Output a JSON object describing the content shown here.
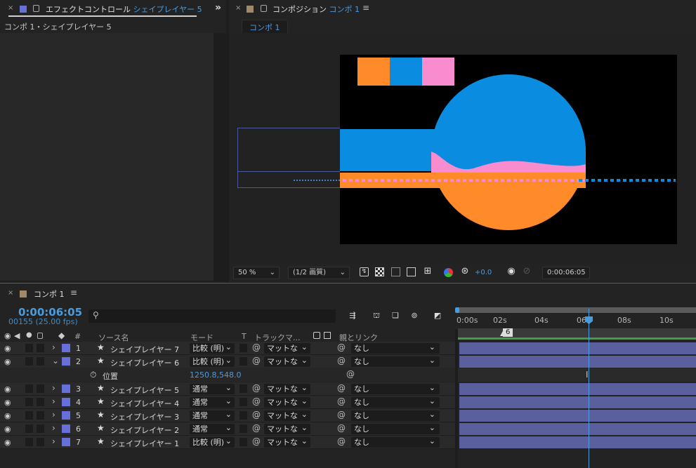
{
  "effect_panel": {
    "close": "×",
    "tab_label": "エフェクトコントロール",
    "tab_layer": "シェイプレイヤー 5",
    "menu_icon": "»",
    "breadcrumb": "コンポ 1・シェイプレイヤー 5",
    "layer_color": "#6670d8"
  },
  "comp_panel": {
    "close": "×",
    "tab_label": "コンポジション",
    "tab_comp": "コンポ 1",
    "menu": "≡",
    "comp_pill": "コンポ 1",
    "swatch_color": "#a08a6a"
  },
  "comp_toolbar": {
    "zoom": "50 %",
    "quality": "(1/2 画質)",
    "exposure": "+0.0",
    "timecode": "0:00:06:05"
  },
  "timeline": {
    "close": "×",
    "tab_label": "コンポ 1",
    "menu": "≡",
    "timecode": "0:00:06:05",
    "frames": "00155 (25.00 fps)",
    "search_placeholder": "",
    "headers": {
      "num": "#",
      "source": "ソース名",
      "mode": "モード",
      "t": "T",
      "track": "トラックマ...",
      "parent": "親とリンク"
    },
    "ruler": [
      "0:00s",
      "02s",
      "04s",
      "06",
      "08s",
      "10s"
    ],
    "marker": "6",
    "prop_name": "位置",
    "prop_value": "1250.8,548.0",
    "layers": [
      {
        "num": "1",
        "name": "シェイプレイヤー 7",
        "mode": "比較 (明)",
        "track": "マットな",
        "parent": "なし",
        "arrow": "›"
      },
      {
        "num": "2",
        "name": "シェイプレイヤー 6",
        "mode": "比較 (明)",
        "track": "マットな",
        "parent": "なし",
        "arrow": "⌄"
      },
      {
        "num": "3",
        "name": "シェイプレイヤー 5",
        "mode": "通常",
        "track": "マットな",
        "parent": "なし",
        "arrow": "›"
      },
      {
        "num": "4",
        "name": "シェイプレイヤー 4",
        "mode": "通常",
        "track": "マットな",
        "parent": "なし",
        "arrow": "›"
      },
      {
        "num": "5",
        "name": "シェイプレイヤー 3",
        "mode": "通常",
        "track": "マットな",
        "parent": "なし",
        "arrow": "›"
      },
      {
        "num": "6",
        "name": "シェイプレイヤー 2",
        "mode": "通常",
        "track": "マットな",
        "parent": "なし",
        "arrow": "›"
      },
      {
        "num": "7",
        "name": "シェイプレイヤー 1",
        "mode": "比較 (明)",
        "track": "マットな",
        "parent": "なし",
        "arrow": "›"
      }
    ]
  },
  "colors": {
    "accent": "#4a9ce0",
    "canvas_blue": "#0a8ce0",
    "canvas_orange": "#ff8a2a",
    "canvas_pink": "#f98ccf",
    "layer_label": "#6670d8",
    "bar": "#5a5f9e",
    "work_area_green": "#3ea03e"
  }
}
